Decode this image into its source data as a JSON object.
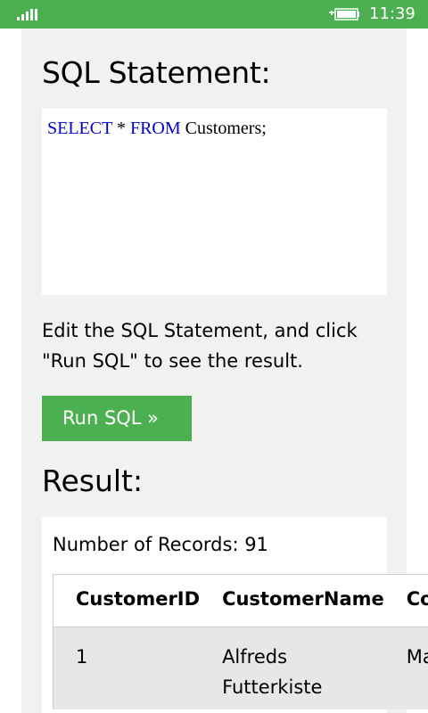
{
  "status_bar": {
    "time": "11:39",
    "signal_icon": "signal-bars-icon",
    "battery_icon": "battery-charging-icon",
    "color": "#4caf50"
  },
  "editor": {
    "heading": "SQL Statement:",
    "keyword_select": "SELECT",
    "star": " * ",
    "keyword_from": "FROM",
    "rest": " Customers;",
    "keyword_color": "#0000cd"
  },
  "hint": {
    "line1": "Edit the SQL Statement, and click",
    "line2": "\"Run SQL\" to see the result."
  },
  "run_button": {
    "label": "Run SQL »",
    "color": "#4caf50"
  },
  "result": {
    "heading": "Result:",
    "record_count": "Number of Records: 91",
    "columns": [
      "CustomerID",
      "CustomerName",
      "ContactName"
    ],
    "rows": [
      [
        "1",
        "Alfreds Futterkiste",
        "Maria Anders"
      ]
    ]
  }
}
